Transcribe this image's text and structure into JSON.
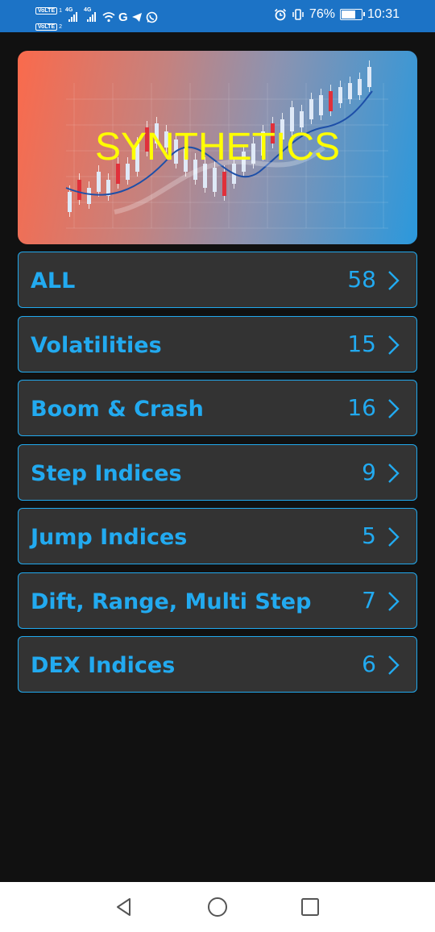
{
  "status_bar": {
    "volte_1": "VoLTE",
    "volte_1_num": "1",
    "volte_2": "VoLTE",
    "volte_2_num": "2",
    "net_1": "4G",
    "net_2": "4G",
    "g_label": "G",
    "battery_text": "76%",
    "battery_level": 0.76,
    "time": "10:31",
    "icons": [
      "signal-icon",
      "wifi-icon",
      "telegram-icon",
      "whatsapp-icon",
      "alarm-icon",
      "vibrate-icon",
      "battery-icon"
    ]
  },
  "banner": {
    "title": "SYNTHETICS"
  },
  "categories": [
    {
      "label": "ALL",
      "count": "58"
    },
    {
      "label": "Volatilities",
      "count": "15"
    },
    {
      "label": "Boom & Crash",
      "count": "16"
    },
    {
      "label": "Step Indices",
      "count": "9"
    },
    {
      "label": "Jump Indices",
      "count": "5"
    },
    {
      "label": "Dift, Range, Multi Step",
      "count": "7"
    },
    {
      "label": "DEX Indices",
      "count": "6"
    }
  ],
  "colors": {
    "accent": "#22aaf0",
    "title_yellow": "#ffff00",
    "status_bar": "#1c73c6",
    "item_bg": "#333333",
    "page_bg": "#111111"
  },
  "nav_bar": {
    "buttons": [
      "back-icon",
      "home-icon",
      "recents-icon"
    ]
  }
}
